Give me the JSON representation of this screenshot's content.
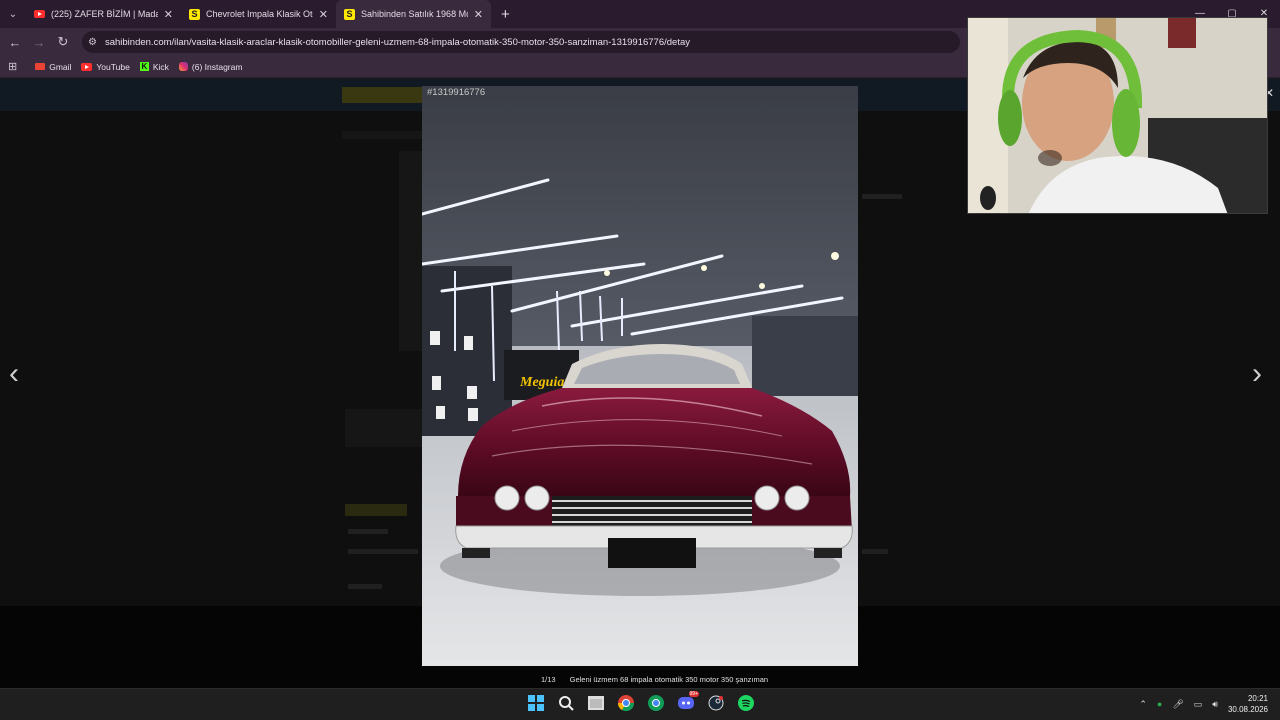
{
  "browser": {
    "tabs": [
      {
        "title": "(225) ZAFER BİZİM | Madara Ol",
        "favicon": "youtube-icon"
      },
      {
        "title": "Chevrolet Impala Klasik Otomo",
        "favicon": "sahibinden-icon"
      },
      {
        "title": "Sahibinden Satılık 1968 Model",
        "favicon": "sahibinden-icon"
      }
    ],
    "url": "sahibinden.com/ilan/vasita-klasik-araclar-klasik-otomobiller-geleni-uzmem-68-impala-otomatik-350-motor-350-sanziman-1319916776/detay",
    "bookmarks": [
      "Gmail",
      "YouTube",
      "Kick",
      "(6) Instagram"
    ]
  },
  "viewer": {
    "listing_id": "#1319916776",
    "counter": "1/13",
    "caption": "Geleni üzmem 68 impala otomatik 350 motor 350 şanzıman",
    "brand_sign": "Meguiar's"
  },
  "taskbar": {
    "time": "20:21",
    "date": "30.08.2026",
    "discord_badge": "99+"
  },
  "colors": {
    "tabbar": "#2a1b2e",
    "toolbar": "#3a2a3e",
    "car_body": "#6b0f2a",
    "accent_yellow": "#ffe800"
  }
}
